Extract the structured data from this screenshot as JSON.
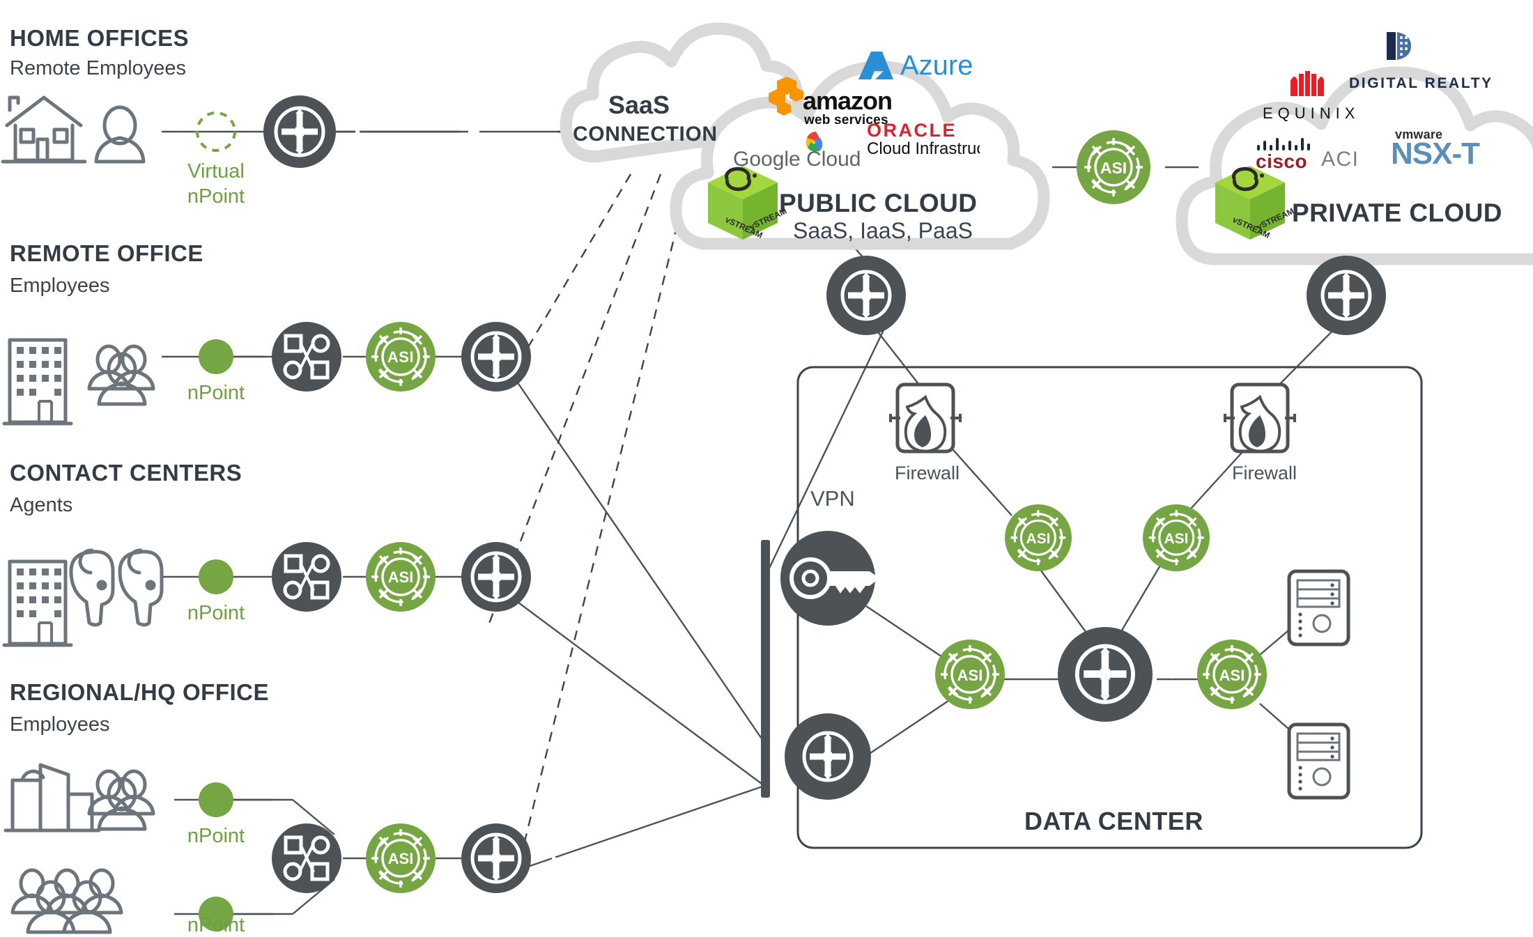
{
  "segments": [
    {
      "id": "home",
      "title": "HOME OFFICES",
      "subtitle": "Remote Employees",
      "npoint_label": "Virtual\nnPoint",
      "npoint_line1": "Virtual",
      "npoint_line2": "nPoint"
    },
    {
      "id": "remote",
      "title": "REMOTE OFFICE",
      "subtitle": "Employees",
      "npoint_label": "nPoint"
    },
    {
      "id": "contact",
      "title": "CONTACT CENTERS",
      "subtitle": "Agents",
      "npoint_label": "nPoint"
    },
    {
      "id": "regional",
      "title": "REGIONAL/HQ OFFICE",
      "subtitle": "Employees",
      "npoint_label": "nPoint",
      "npoint_label2": "nPoint"
    }
  ],
  "saas_cloud": {
    "line1": "SaaS",
    "line2": "CONNECTION"
  },
  "public_cloud": {
    "title": "PUBLIC CLOUD",
    "subtitle": "SaaS, IaaS, PaaS",
    "logos": [
      {
        "name": "azure",
        "text": "Azure"
      },
      {
        "name": "amazon-web-services",
        "text": "amazon",
        "subtext": "web services"
      },
      {
        "name": "oracle-cloud-infrastructure",
        "text": "ORACLE",
        "subtext": "Cloud Infrastructure"
      },
      {
        "name": "google-cloud",
        "text": "Google Cloud"
      }
    ],
    "vstream_label": "vSTREAM"
  },
  "private_cloud": {
    "title": "PRIVATE CLOUD",
    "logos": [
      {
        "name": "digital-realty",
        "text": "DIGITAL REALTY"
      },
      {
        "name": "equinix",
        "text": "EQUINIX"
      },
      {
        "name": "cisco-aci",
        "text": "cisco",
        "subtext": "ACI"
      },
      {
        "name": "vmware-nsx-t",
        "text": "vmware",
        "subtext": "NSX-T"
      }
    ],
    "vstream_label": "vSTREAM"
  },
  "data_center": {
    "title": "DATA CENTER",
    "vpn_label": "VPN",
    "firewall_left_label": "Firewall",
    "firewall_right_label": "Firewall"
  },
  "asi_label": "ASI",
  "colors": {
    "green": "#76a544",
    "dark": "#4d5256",
    "cloud_grey": "#d9d9d9",
    "text": "#333c44",
    "line": "#4a535b",
    "vstream_green": "#8dc63f"
  }
}
